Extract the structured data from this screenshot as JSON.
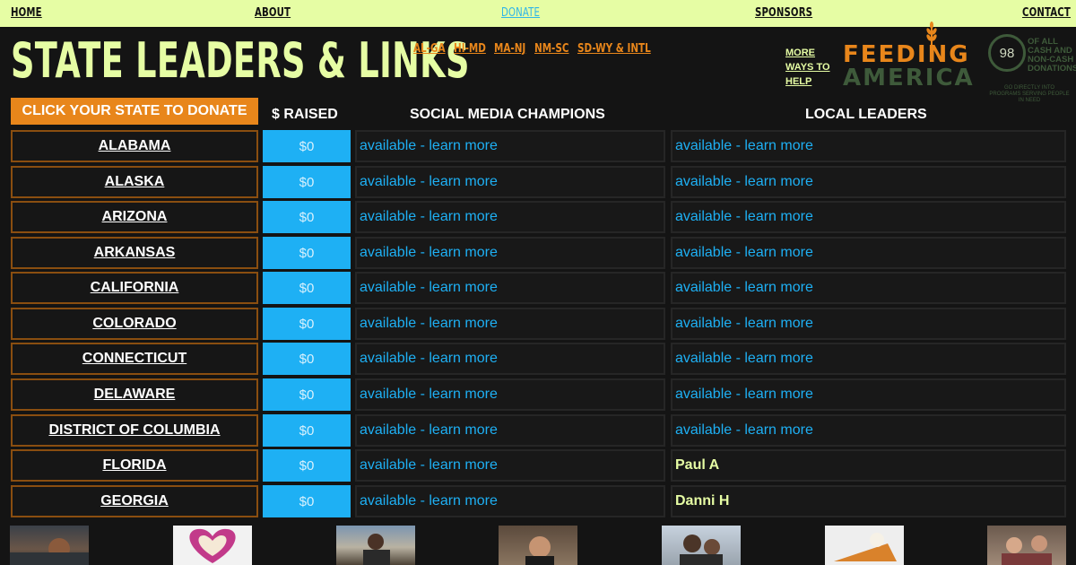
{
  "nav": {
    "home": "HOME",
    "about": "ABOUT",
    "donate": "DONATE",
    "sponsors": "SPONSORS",
    "contact": "CONTACT"
  },
  "header": {
    "title": "STATE LEADERS & LINKS",
    "ranges": [
      "AL-GA",
      "HI-MD",
      "MA-NJ",
      "NM-SC",
      "SD-WY & INTL"
    ],
    "more_ways": "MORE WAYS TO HELP",
    "logo_line1": "FEEDING",
    "logo_line2": "AMERICA",
    "badge_number": "98",
    "badge_note": "OF ALL CASH AND NON-CASH DONATIONS",
    "badge_fine": "GO DIRECTLY INTO PROGRAMS SERVING PEOPLE IN NEED"
  },
  "table": {
    "donate_button": "CLICK YOUR STATE TO DONATE",
    "col_raised": "$ RAISED",
    "col_social": "SOCIAL MEDIA CHAMPIONS",
    "col_local": "LOCAL LEADERS",
    "rows": [
      {
        "state": "ALABAMA",
        "raised": "$0",
        "social": "available - learn more",
        "local": "available - learn more"
      },
      {
        "state": "ALASKA",
        "raised": "$0",
        "social": "available - learn more",
        "local": "available - learn more"
      },
      {
        "state": "ARIZONA",
        "raised": "$0",
        "social": "available - learn more",
        "local": "available - learn more"
      },
      {
        "state": "ARKANSAS",
        "raised": "$0",
        "social": "available - learn more",
        "local": "available - learn more"
      },
      {
        "state": "CALIFORNIA",
        "raised": "$0",
        "social": "available - learn more",
        "local": "available - learn more"
      },
      {
        "state": "COLORADO",
        "raised": "$0",
        "social": "available - learn more",
        "local": "available - learn more"
      },
      {
        "state": "CONNECTICUT",
        "raised": "$0",
        "social": "available - learn more",
        "local": "available - learn more"
      },
      {
        "state": "DELAWARE",
        "raised": "$0",
        "social": "available - learn more",
        "local": "available - learn more"
      },
      {
        "state": "DISTRICT OF COLUMBIA",
        "raised": "$0",
        "social": "available - learn more",
        "local": "available - learn more"
      },
      {
        "state": "FLORIDA",
        "raised": "$0",
        "social": "available - learn more",
        "local": "Paul A"
      },
      {
        "state": "GEORGIA",
        "raised": "$0",
        "social": "available - learn more",
        "local": "Danni H"
      }
    ]
  },
  "colors": {
    "lime": "#e6fda4",
    "orange": "#e8861b",
    "blue": "#1eb0f4",
    "background": "#141414",
    "logo_green": "#3e5a3a"
  },
  "icons": {
    "wheat": "wheat-icon"
  }
}
